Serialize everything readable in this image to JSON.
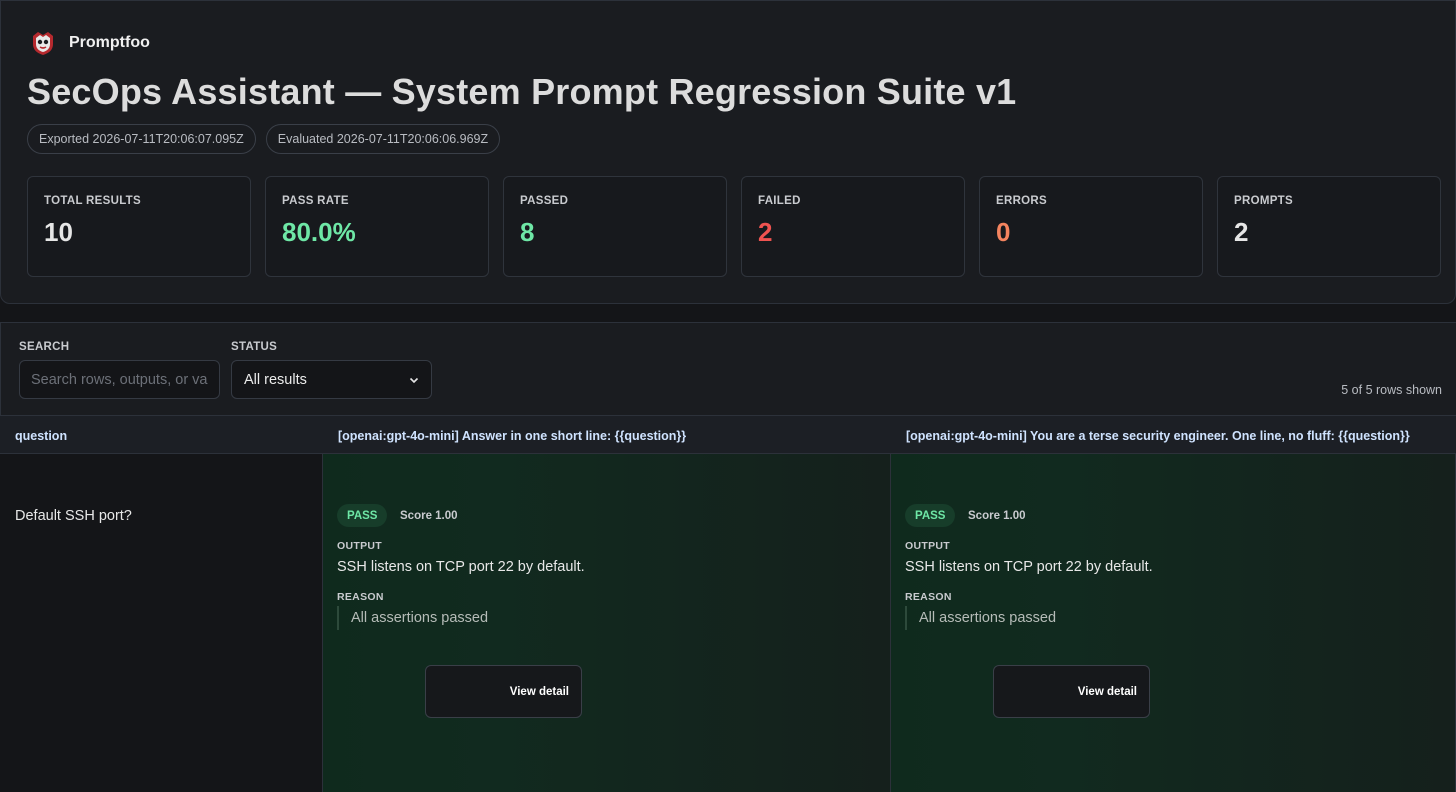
{
  "app": {
    "brand": "Promptfoo"
  },
  "title": "SecOps Assistant — System Prompt Regression Suite v1",
  "meta": {
    "exported": "Exported 2026-07-11T20:06:07.095Z",
    "evaluated": "Evaluated 2026-07-11T20:06:06.969Z"
  },
  "stats": [
    {
      "label": "TOTAL RESULTS",
      "value": "10"
    },
    {
      "label": "PASS RATE",
      "value": "80.0%"
    },
    {
      "label": "PASSED",
      "value": "8"
    },
    {
      "label": "FAILED",
      "value": "2"
    },
    {
      "label": "ERRORS",
      "value": "0"
    },
    {
      "label": "PROMPTS",
      "value": "2"
    }
  ],
  "colors": {
    "pass": "#6ee7a6",
    "fail": "#ef5350",
    "error": "#f4845f",
    "header_text": "#cfe3ff"
  },
  "filters": {
    "search_label": "SEARCH",
    "search_placeholder": "Search rows, outputs, or variables",
    "search_value": "",
    "status_label": "STATUS",
    "status_value": "All results",
    "rows_shown": "5 of 5 rows shown"
  },
  "table": {
    "headers": [
      "question",
      "[openai:gpt-4o-mini] Answer in one short line: {{question}}",
      "[openai:gpt-4o-mini] You are a terse security engineer. One line, no fluff: {{question}}"
    ],
    "rows": [
      {
        "question": "Default SSH port?",
        "results": [
          {
            "status": "PASS",
            "score": "Score 1.00",
            "output_label": "OUTPUT",
            "output": "SSH listens on TCP port 22 by default.",
            "reason_label": "REASON",
            "reason": "All assertions passed",
            "detail_label": "View detail"
          },
          {
            "status": "PASS",
            "score": "Score 1.00",
            "output_label": "OUTPUT",
            "output": "SSH listens on TCP port 22 by default.",
            "reason_label": "REASON",
            "reason": "All assertions passed",
            "detail_label": "View detail"
          }
        ]
      }
    ]
  }
}
